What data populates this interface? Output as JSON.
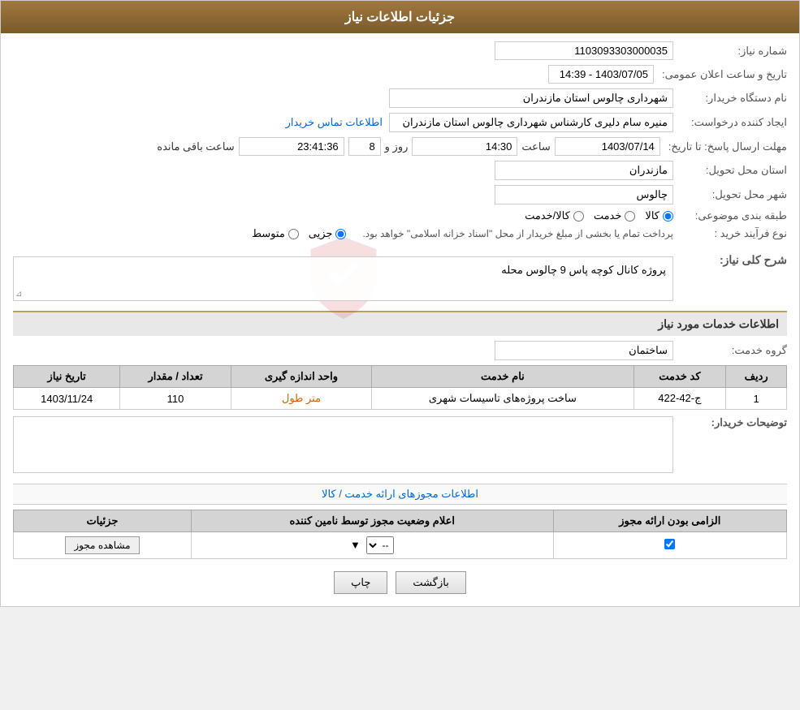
{
  "header": {
    "title": "جزئیات اطلاعات نیاز"
  },
  "fields": {
    "tender_number_label": "شماره نیاز:",
    "tender_number_value": "1103093303000035",
    "buyer_label": "نام دستگاه خریدار:",
    "buyer_value": "شهرداری چالوس استان مازندران",
    "creator_label": "ایجاد کننده درخواست:",
    "creator_value": "منیره سام دلیری کارشناس شهرداری چالوس استان مازندران",
    "creator_link": "اطلاعات تماس خریدار",
    "date_label": "تاریخ و ساعت اعلان عمومی:",
    "date_value": "1403/07/05 - 14:39",
    "deadline_label": "مهلت ارسال پاسخ: تا تاریخ:",
    "deadline_date": "1403/07/14",
    "deadline_time_label": "ساعت",
    "deadline_time": "14:30",
    "deadline_days_label": "روز و",
    "deadline_days": "8",
    "deadline_remaining": "23:41:36",
    "deadline_remaining_label": "ساعت باقی مانده",
    "province_label": "استان محل تحویل:",
    "province_value": "مازندران",
    "city_label": "شهر محل تحویل:",
    "city_value": "چالوس",
    "category_label": "طبقه بندی موضوعی:",
    "category_options": [
      "کالا",
      "خدمت",
      "کالا/خدمت"
    ],
    "category_selected": "کالا",
    "purchase_type_label": "نوع فرآیند خرید :",
    "purchase_options": [
      "جزیی",
      "متوسط"
    ],
    "purchase_note": "پرداخت تمام یا بخشی از مبلغ خریدار از محل \"اسناد خزانه اسلامی\" خواهد بود."
  },
  "need_description": {
    "section_title": "شرح کلی نیاز:",
    "text": "پروژه کانال کوچه پاس 9 چالوس محله"
  },
  "services_section": {
    "title": "اطلاعات خدمات مورد نیاز",
    "group_label": "گروه خدمت:",
    "group_value": "ساختمان",
    "table_headers": [
      "ردیف",
      "کد خدمت",
      "نام خدمت",
      "واحد اندازه گیری",
      "تعداد / مقدار",
      "تاریخ نیاز"
    ],
    "table_rows": [
      {
        "row": "1",
        "code": "ج-42-422",
        "name": "ساخت پروژه‌های تاسیسات شهری",
        "unit": "متر طول",
        "quantity": "110",
        "date": "1403/11/24"
      }
    ]
  },
  "buyer_notes": {
    "label": "توضیحات خریدار:",
    "text": ""
  },
  "permissions": {
    "title": "اطلاعات مجوزهای ارائه خدمت / کالا",
    "table_headers": [
      "الزامی بودن ارائه مجوز",
      "اعلام وضعیت مجوز توسط نامین کننده",
      "جزئیات"
    ],
    "table_rows": [
      {
        "required": true,
        "status_value": "--",
        "details_btn": "مشاهده مجوز"
      }
    ]
  },
  "buttons": {
    "print": "چاپ",
    "back": "بازگشت"
  }
}
